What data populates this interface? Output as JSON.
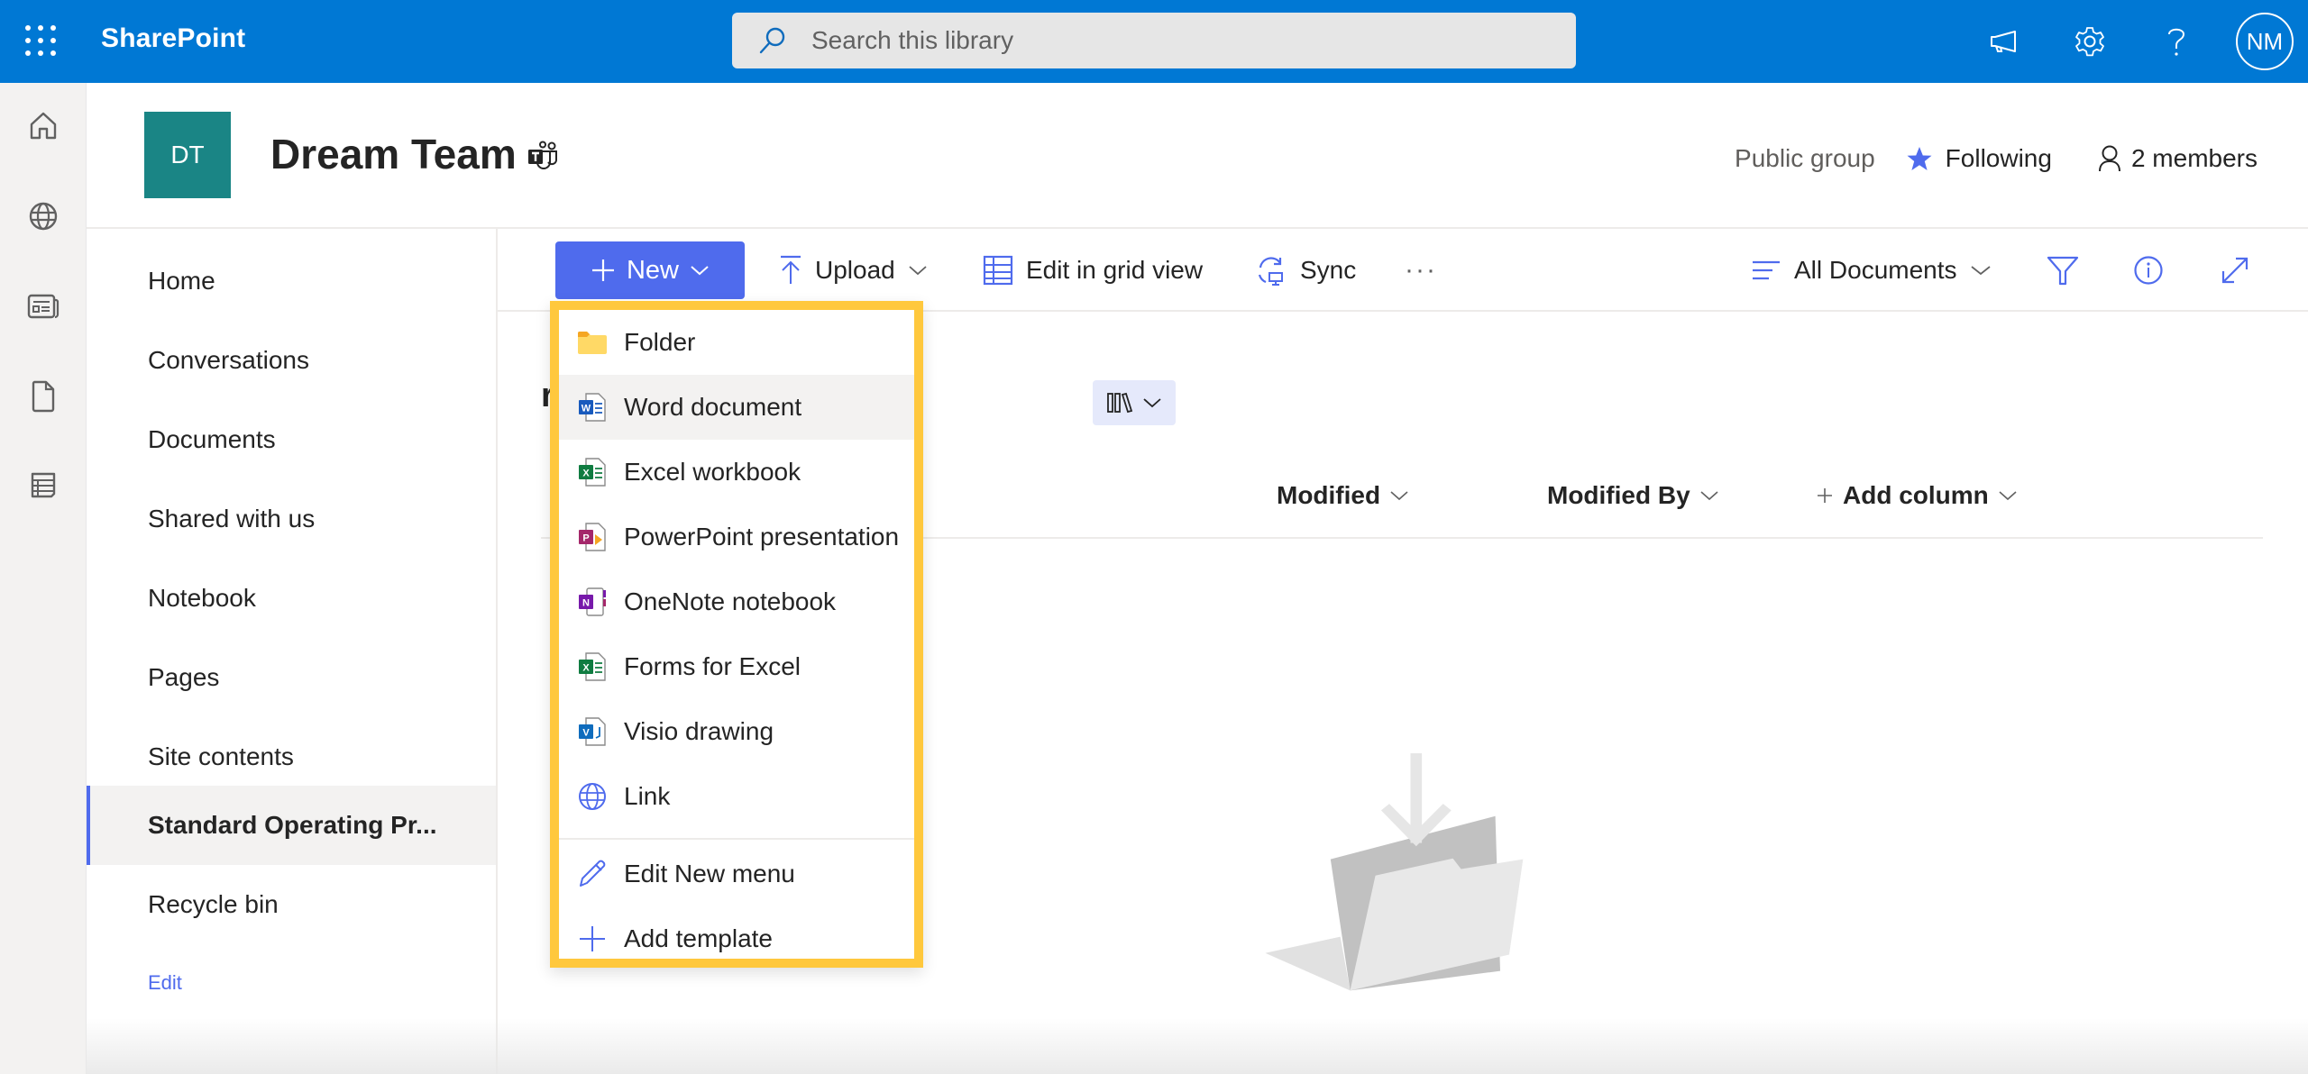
{
  "suite": {
    "app_name": "SharePoint",
    "search_placeholder": "Search this library",
    "avatar_initials": "NM",
    "accent": "#0078d4"
  },
  "rail": {
    "items": [
      {
        "icon": "home-icon",
        "label": "Home"
      },
      {
        "icon": "globe-icon",
        "label": "Sites"
      },
      {
        "icon": "news-icon",
        "label": "News"
      },
      {
        "icon": "file-icon",
        "label": "Files"
      },
      {
        "icon": "list-icon",
        "label": "Lists"
      }
    ]
  },
  "site": {
    "logo_initials": "DT",
    "logo_color": "#1a8585",
    "title": "Dream Team",
    "privacy": "Public group",
    "follow_label": "Following",
    "members_label": "2 members"
  },
  "sitenav": {
    "items": [
      {
        "label": "Home",
        "active": false
      },
      {
        "label": "Conversations",
        "active": false
      },
      {
        "label": "Documents",
        "active": false
      },
      {
        "label": "Shared with us",
        "active": false
      },
      {
        "label": "Notebook",
        "active": false
      },
      {
        "label": "Pages",
        "active": false
      },
      {
        "label": "Site contents",
        "active": false
      },
      {
        "label": "Standard Operating Pr...",
        "active": true
      },
      {
        "label": "Recycle bin",
        "active": false
      }
    ],
    "edit_label": "Edit"
  },
  "commandbar": {
    "new_label": "New",
    "upload_label": "Upload",
    "grid_label": "Edit in grid view",
    "sync_label": "Sync",
    "more_label": "···",
    "view_label": "All Documents",
    "brand_color": "#4f6bed"
  },
  "library": {
    "title_visible": "rocedures",
    "columns": [
      {
        "label": "Modified"
      },
      {
        "label": "Modified By"
      },
      {
        "label": "Add column"
      }
    ]
  },
  "new_menu": {
    "highlight_color": "#ffc83d",
    "items": [
      {
        "label": "Folder",
        "icon": "folder-icon"
      },
      {
        "label": "Word document",
        "icon": "word-icon",
        "hovered": true
      },
      {
        "label": "Excel workbook",
        "icon": "excel-icon"
      },
      {
        "label": "PowerPoint presentation",
        "icon": "powerpoint-icon"
      },
      {
        "label": "OneNote notebook",
        "icon": "onenote-icon"
      },
      {
        "label": "Forms for Excel",
        "icon": "forms-excel-icon"
      },
      {
        "label": "Visio drawing",
        "icon": "visio-icon"
      },
      {
        "label": "Link",
        "icon": "link-globe-icon"
      }
    ],
    "footer_items": [
      {
        "label": "Edit New menu",
        "icon": "pencil-icon"
      },
      {
        "label": "Add template",
        "icon": "plus-icon"
      }
    ]
  }
}
